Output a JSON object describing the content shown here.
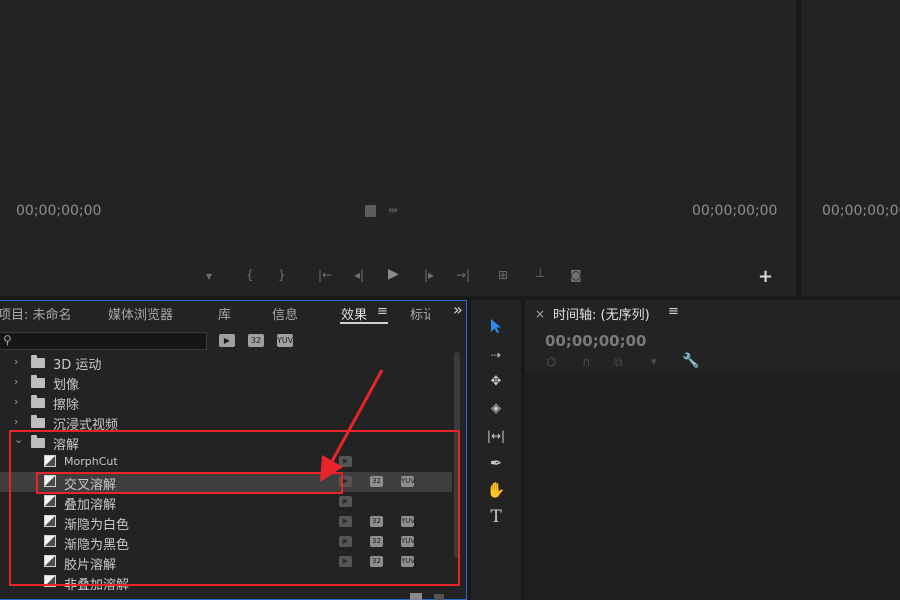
{
  "source_monitor": {
    "timecode_left": "00;00;00;00",
    "timecode_right": "00;00;00;00"
  },
  "program_monitor": {
    "timecode_left": "00;00;00;00"
  },
  "transport_add": "+",
  "panel_tabs": [
    {
      "label": "项目: 未命名"
    },
    {
      "label": "媒体浏览器"
    },
    {
      "label": "库"
    },
    {
      "label": "信息"
    },
    {
      "label": "效果"
    },
    {
      "label": "标记"
    }
  ],
  "panel_more": "»",
  "effects_search": {
    "placeholder": "",
    "value": ""
  },
  "filter_badges": [
    "",
    "32",
    "YUV"
  ],
  "tree": {
    "folders": [
      {
        "label": "3D 运动"
      },
      {
        "label": "划像"
      },
      {
        "label": "擦除"
      },
      {
        "label": "沉浸式视频"
      },
      {
        "label": "溶解"
      }
    ],
    "items": [
      {
        "label": "MorphCut"
      },
      {
        "label": "交叉溶解"
      },
      {
        "label": "叠加溶解"
      },
      {
        "label": "渐隐为白色"
      },
      {
        "label": "渐隐为黑色"
      },
      {
        "label": "胶片溶解"
      },
      {
        "label": "非叠加溶解"
      }
    ],
    "badge_32": "32",
    "badge_yuv": "YUV"
  },
  "timeline": {
    "close": "×",
    "title": "时间轴: (无序列)",
    "menu": "≡",
    "timecode": "00;00;00;00"
  },
  "tools": [
    "selection-tool",
    "track-select-forward-tool",
    "ripple-edit-tool",
    "razor-tool",
    "slip-tool",
    "pen-tool",
    "hand-tool",
    "type-tool"
  ],
  "annotation": {
    "color": "#e8232a"
  }
}
